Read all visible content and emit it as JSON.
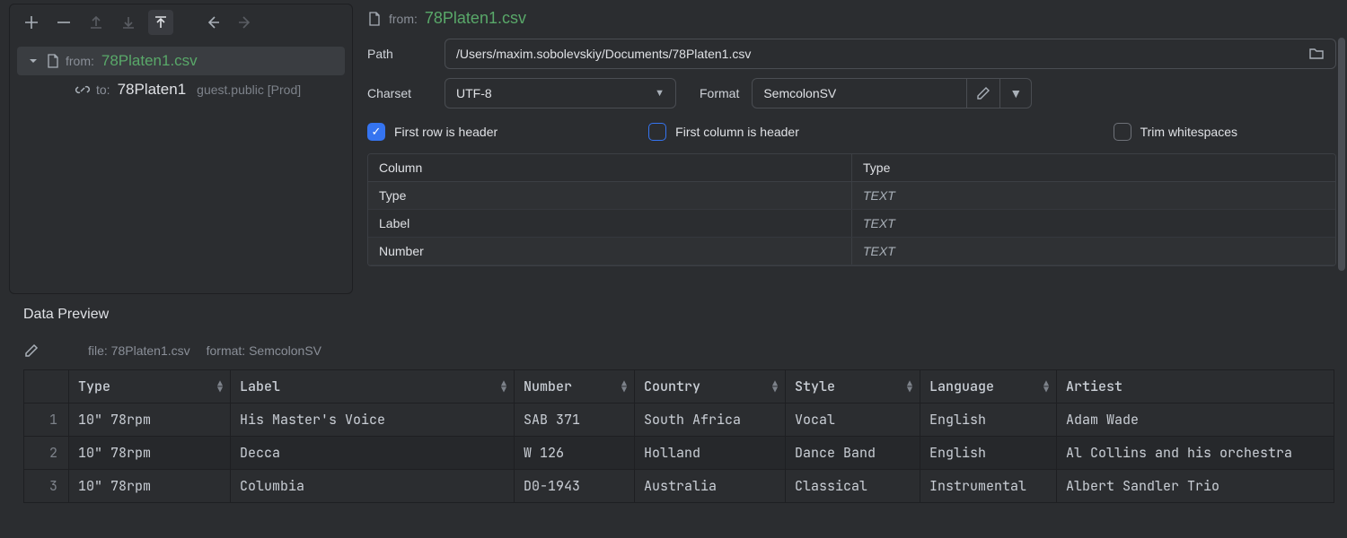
{
  "sidebar": {
    "from_label": "from:",
    "from_name": "78Platen1.csv",
    "to_label": "to:",
    "to_name": "78Platen1",
    "to_suffix": "guest.public [Prod]"
  },
  "header": {
    "from_label": "from:",
    "file_name": "78Platen1.csv"
  },
  "form": {
    "path_label": "Path",
    "path_value": "/Users/maxim.sobolevskiy/Documents/78Platen1.csv",
    "charset_label": "Charset",
    "charset_value": "UTF-8",
    "format_label": "Format",
    "format_value": "SemcolonSV",
    "first_row_header": "First row is header",
    "first_col_header": "First column is header",
    "trim_ws": "Trim whitespaces"
  },
  "columns_table": {
    "h1": "Column",
    "h2": "Type",
    "rows": [
      {
        "name": "Type",
        "type": "TEXT"
      },
      {
        "name": "Label",
        "type": "TEXT"
      },
      {
        "name": "Number",
        "type": "TEXT"
      }
    ]
  },
  "preview": {
    "title": "Data Preview",
    "file_label": "file: 78Platen1.csv",
    "format_label": "format: SemcolonSV",
    "headers": [
      "Type",
      "Label",
      "Number",
      "Country",
      "Style",
      "Language",
      "Artiest"
    ],
    "rows": [
      [
        "10\" 78rpm",
        "His Master's Voice",
        "SAB 371",
        "South Africa",
        "Vocal",
        "English",
        "Adam Wade"
      ],
      [
        "10\" 78rpm",
        "Decca",
        "W 126",
        "Holland",
        "Dance Band",
        "English",
        "Al Collins and his orchestra"
      ],
      [
        "10\" 78rpm",
        "Columbia",
        "D0-1943",
        "Australia",
        "Classical",
        "Instrumental",
        "Albert Sandler Trio"
      ]
    ]
  }
}
